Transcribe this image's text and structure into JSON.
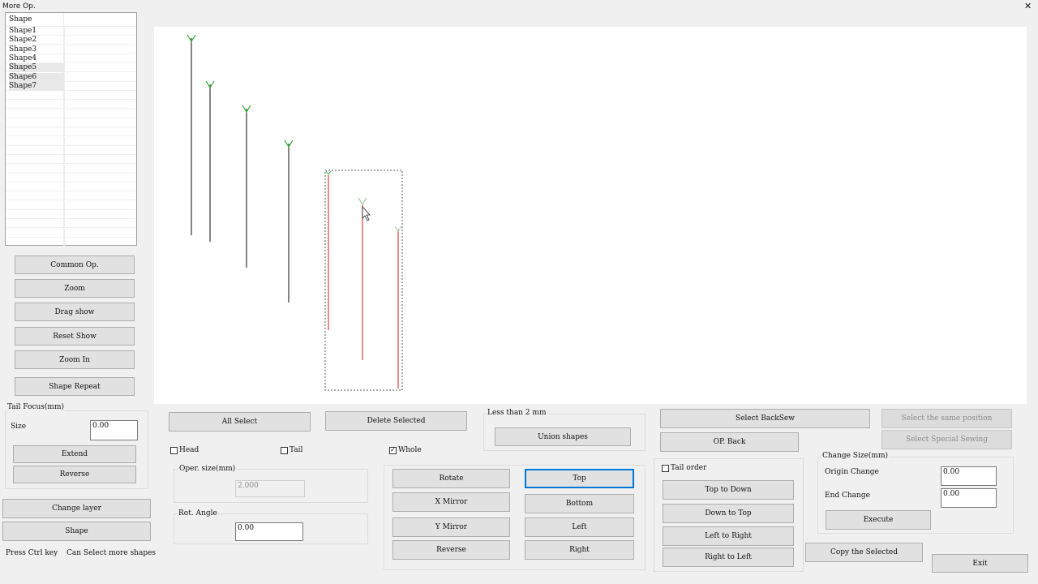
{
  "window": {
    "title": "More Op.",
    "close_glyph": "✕"
  },
  "shape_list": {
    "header": "Shape",
    "items": [
      "Shape1",
      "Shape2",
      "Shape3",
      "Shape4",
      "Shape5",
      "Shape6",
      "Shape7"
    ],
    "highlighted_items": [
      "Shape5",
      "Shape6",
      "Shape7"
    ]
  },
  "left_buttons": {
    "common_op": "Common Op.",
    "zoom": "Zoom",
    "drag_show": "Drag show",
    "reset_show": "Reset Show",
    "zoom_in": "Zoom In",
    "shape_repeat": "Shape Repeat"
  },
  "tail_focus": {
    "title": "Tail Focus(mm)",
    "size_label": "Size",
    "size_value": "0.00",
    "extend": "Extend",
    "reverse": "Reverse"
  },
  "bottom_left": {
    "change_layer": "Change layer",
    "shape": "Shape",
    "hint_ctrl": "Press Ctrl key",
    "hint_select": "Can Select more shapes"
  },
  "selection": {
    "all_select": "All Select",
    "delete_selected": "Delete Selected",
    "head_label": "Head",
    "head_checked": false,
    "tail_label": "Tail",
    "tail_checked": false,
    "whole_label": "Whole",
    "whole_checked": true
  },
  "union": {
    "title": "Less than 2 mm",
    "button": "Union shapes"
  },
  "oper_size": {
    "label": "Oper. size(mm)",
    "value": "2.000"
  },
  "rot_angle": {
    "label": "Rot. Angle",
    "value": "0.00"
  },
  "transform": {
    "rotate": "Rotate",
    "x_mirror": "X Mirror",
    "y_mirror": "Y Mirror",
    "reverse": "Reverse",
    "top": "Top",
    "bottom": "Bottom",
    "left": "Left",
    "right": "Right"
  },
  "backsew": {
    "select_backsew": "Select BackSew",
    "op_back": "OP. Back"
  },
  "tail_order": {
    "label": "Tail order",
    "checked": false,
    "top_to_down": "Top to Down",
    "down_to_top": "Down to Top",
    "left_to_right": "Left to Right",
    "right_to_left": "Right to Left"
  },
  "right_disabled": {
    "same_position": "Select the same position",
    "special_sewing": "Select Special Sewing"
  },
  "change_size": {
    "title": "Change Size(mm)",
    "origin_label": "Origin Change",
    "origin_value": "0.00",
    "end_label": "End Change",
    "end_value": "0.00",
    "execute": "Execute"
  },
  "copy_selected": "Copy the Selected",
  "exit": "Exit",
  "colors": {
    "line_unselected": "#333333",
    "line_selected": "#d04040",
    "head_marker": "#35b035",
    "selection_box": "#555555"
  }
}
